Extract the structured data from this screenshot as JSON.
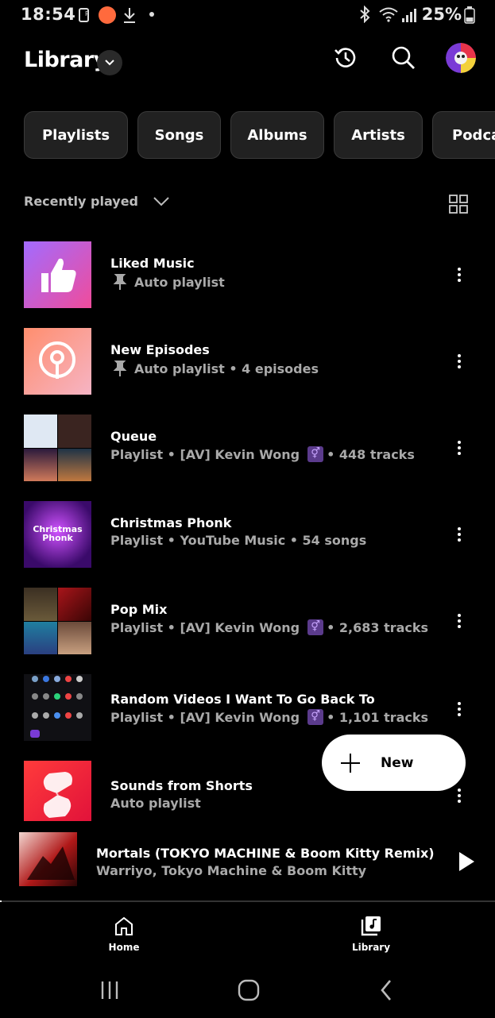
{
  "status_bar": {
    "time": "18:54",
    "battery_pct": "25%",
    "icons": [
      "sim-icon",
      "app-notification-icon",
      "download-icon",
      "dot-icon",
      "bluetooth-icon",
      "wifi-icon",
      "signal-icon",
      "battery-icon"
    ]
  },
  "header": {
    "title": "Library",
    "icons": [
      "chevron-down-icon",
      "history-icon",
      "search-icon",
      "avatar"
    ]
  },
  "chips": [
    "Playlists",
    "Songs",
    "Albums",
    "Artists",
    "Podca"
  ],
  "sort": {
    "label": "Recently played"
  },
  "items": [
    {
      "title": "Liked Music",
      "subtitle": "Auto playlist",
      "pinned": true,
      "thumb": "thumbs-up"
    },
    {
      "title": "New Episodes",
      "subtitle": "Auto playlist • 4 episodes",
      "pinned": true,
      "thumb": "podcast"
    },
    {
      "title": "Queue",
      "subtitle_pre": "Playlist • [AV] Kevin Wong",
      "subtitle_post": " • 448 tracks",
      "badge": true,
      "thumb": "collage1"
    },
    {
      "title": "Christmas Phonk",
      "subtitle": "Playlist • YouTube Music • 54 songs",
      "thumb": "christmas",
      "thumb_text": "Christmas Phonk"
    },
    {
      "title": "Pop Mix",
      "subtitle_pre": "Playlist • [AV] Kevin Wong",
      "subtitle_post": " • 2,683 tracks",
      "badge": true,
      "thumb": "collage2"
    },
    {
      "title": "Random Videos I Want To Go Back To",
      "subtitle_pre": "Playlist • [AV] Kevin Wong",
      "subtitle_post": " • 1,101 tracks",
      "badge": true,
      "thumb": "apps"
    },
    {
      "title": "Sounds from Shorts",
      "subtitle": "Auto playlist",
      "thumb": "shorts"
    }
  ],
  "fab": {
    "label": "New"
  },
  "mini_player": {
    "title": "Mortals (TOKYO MACHINE & Boom Kitty Remix)",
    "artist": "Warriyo, Tokyo Machine & Boom Kitty",
    "progress": 0.002
  },
  "nav": [
    {
      "label": "Home",
      "icon": "home-icon"
    },
    {
      "label": "Library",
      "icon": "library-icon",
      "active": true
    }
  ],
  "system_nav": [
    "recents-icon",
    "home-circle-icon",
    "back-icon"
  ]
}
